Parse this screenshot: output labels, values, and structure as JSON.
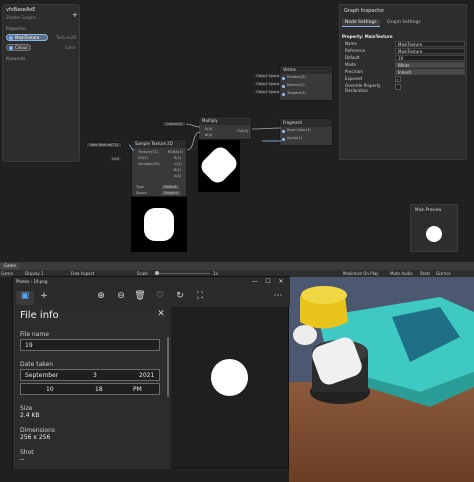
{
  "blackboard": {
    "title": "vfxBaseAoE",
    "subtitle": "Shader Graphs",
    "add_label": "+",
    "section_properties": "Properties",
    "properties": [
      {
        "name": "MainTexture",
        "type": "Texture2D"
      },
      {
        "name": "Colour",
        "type": "Color"
      }
    ],
    "section_keywords": "Keywords"
  },
  "nodes": {
    "vertex": {
      "title": "Vertex",
      "ports": [
        "Position(3)",
        "Normal(3)",
        "Tangent(3)"
      ],
      "inputs": [
        "Object Space",
        "Object Space",
        "Object Space"
      ]
    },
    "fragment": {
      "title": "Fragment",
      "ports": [
        "Base Color(3)",
        "Alpha(1)"
      ]
    },
    "multiply": {
      "title": "Multiply",
      "ports": [
        "A(4)",
        "B(4)",
        "Out(4)"
      ]
    },
    "sample": {
      "title": "Sample Texture 2D",
      "ports": [
        "Texture(T2)",
        "UV(2)",
        "Sampler(SS)",
        "RGBA(4)",
        "R(1)",
        "G(1)",
        "B(1)",
        "A(1)"
      ],
      "type_label": "Type",
      "type_value": "Default",
      "space_label": "Space",
      "space_value": "Tangent"
    },
    "colour_prop": "Colour(4)",
    "texture_prop": "MainTexture(T2)",
    "uv_label": "UV0"
  },
  "inspector": {
    "title": "Graph Inspector",
    "tabs": [
      "Node Settings",
      "Graph Settings"
    ],
    "heading": "Property: MainTexture",
    "rows": [
      {
        "label": "Name",
        "value": "MainTexture"
      },
      {
        "label": "Reference",
        "value": "MainTexture"
      },
      {
        "label": "Default",
        "value": "19"
      },
      {
        "label": "Mode",
        "value": "White"
      },
      {
        "label": "Precision",
        "value": "Inherit"
      },
      {
        "label": "Exposed",
        "value": "✓"
      },
      {
        "label": "Override Property Declaration",
        "value": ""
      }
    ]
  },
  "main_preview": {
    "title": "Main Preview"
  },
  "game": {
    "tab": "Game",
    "toolbar": {
      "view": "Game",
      "display": "Display 1",
      "aspect": "Free Aspect",
      "scale_label": "Scale",
      "scale_value": "1x",
      "maximize": "Maximize On Play",
      "mute": "Mute Audio",
      "stats": "Stats",
      "gizmos": "Gizmos"
    }
  },
  "photos": {
    "title": "Photos - 19.png",
    "panel_title": "File info",
    "file_name_label": "File name",
    "file_name": "19",
    "date_label": "Date taken",
    "month": "September",
    "day": "3",
    "year": "2021",
    "hour": "10",
    "minute": "18",
    "ampm": "PM",
    "size_label": "Size",
    "size": "2.4 KB",
    "dimensions_label": "Dimensions",
    "dimensions": "256 x 256",
    "shot_label": "Shot",
    "shot": "--"
  },
  "colors": {
    "accent": "#88b5e8",
    "photo_bg": "#1f1f1f",
    "teal": "#3ec9c2",
    "yellow": "#e8c41c"
  }
}
